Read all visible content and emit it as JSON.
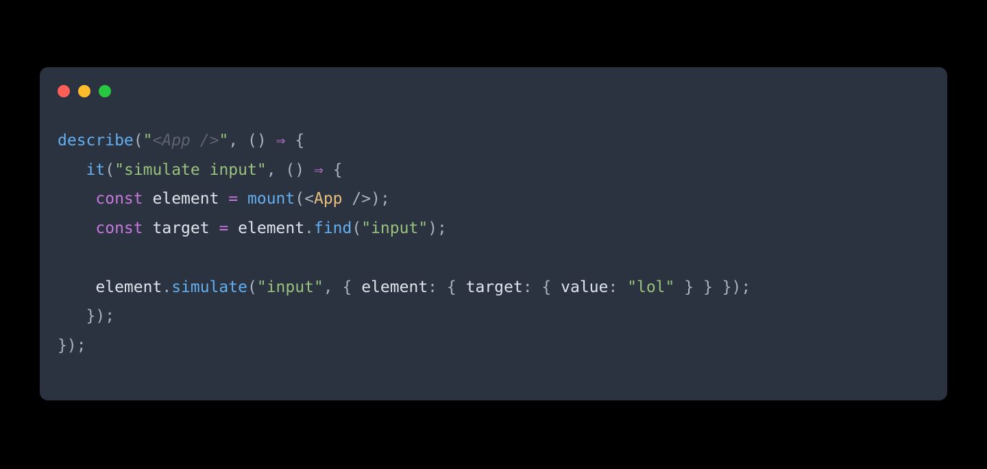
{
  "traffic_lights": {
    "red": "#ff5f57",
    "yellow": "#ffbd2e",
    "green": "#28c840"
  },
  "code": {
    "fn_describe": "describe",
    "fn_it": "it",
    "fn_mount": "mount",
    "method_find": "find",
    "method_simulate": "simulate",
    "kw_const": "const",
    "var_element": "element",
    "var_target": "target",
    "prop_element": "element",
    "prop_target": "target",
    "prop_value": "value",
    "jsx_component": "App",
    "str_app": "<App />",
    "str_simulate_input": "simulate input",
    "str_input": "input",
    "str_input2": "input",
    "str_lol": "lol",
    "quote": "\"",
    "arrow": "⇒",
    "op_eq": "=",
    "lt": "<",
    "selfclose": "/>",
    "indent1": "   ",
    "indent2": "    ",
    "lparen": "(",
    "rparen": ")",
    "lbrace": "{",
    "rbrace": "}",
    "semi": ";",
    "comma": ",",
    "dot": ".",
    "colon": ":",
    "space": " "
  }
}
